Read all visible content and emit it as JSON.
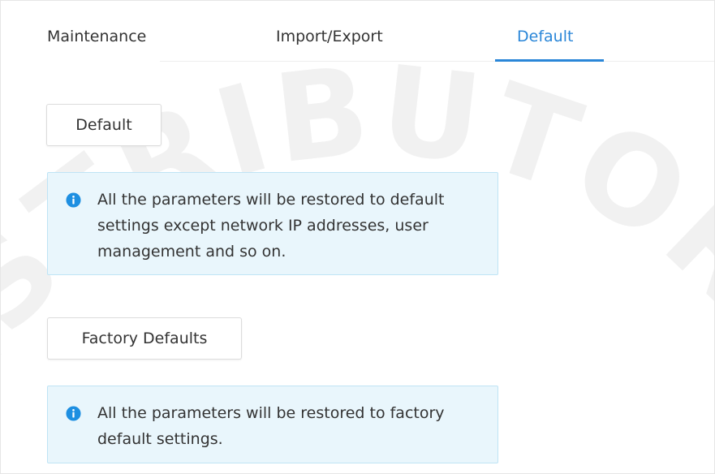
{
  "tabs": [
    {
      "label": "Maintenance",
      "active": false
    },
    {
      "label": "Import/Export",
      "active": false
    },
    {
      "label": "Default",
      "active": true
    }
  ],
  "default_section": {
    "button_label": "Default",
    "notice_text": "All the parameters will be restored to default settings except network IP addresses, user management and so on."
  },
  "factory_section": {
    "button_label": "Factory Defaults",
    "notice_text": "All the parameters will be restored to factory default settings."
  },
  "watermark_text": "DISTRIBUTOR",
  "colors": {
    "accent": "#2a86d8",
    "notice_bg": "#e9f6fc",
    "notice_border": "#bfe4f5",
    "info_icon": "#1e8fe1"
  }
}
